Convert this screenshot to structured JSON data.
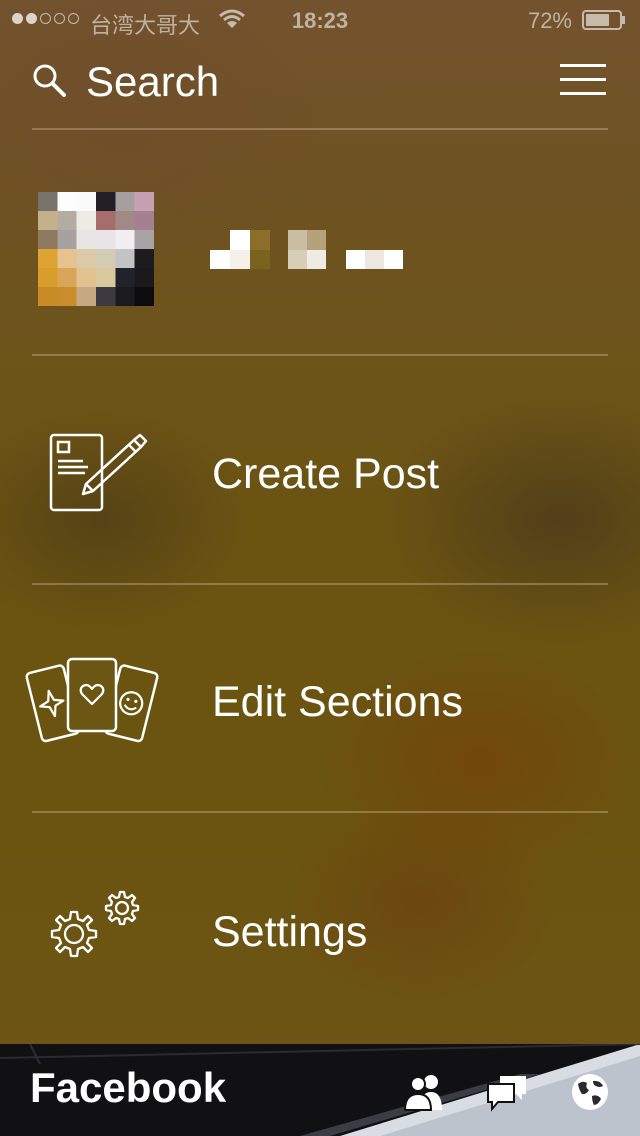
{
  "status_bar": {
    "carrier": "台湾大哥大",
    "time": "18:23",
    "battery_percent": "72%",
    "battery_level": 0.72,
    "signal_bars_filled": 2,
    "signal_bars_total": 5
  },
  "header": {
    "search_label": "Search",
    "search_icon": "search-icon",
    "menu_icon": "hamburger-menu-icon"
  },
  "menu": {
    "items": [
      {
        "label": "Create Post",
        "icon": "compose-icon"
      },
      {
        "label": "Edit Sections",
        "icon": "cards-icon"
      },
      {
        "label": "Settings",
        "icon": "gear-icon"
      }
    ]
  },
  "bottom_bar": {
    "brand": "Facebook",
    "icons": [
      "friends-icon",
      "messages-icon",
      "globe-icon"
    ]
  }
}
